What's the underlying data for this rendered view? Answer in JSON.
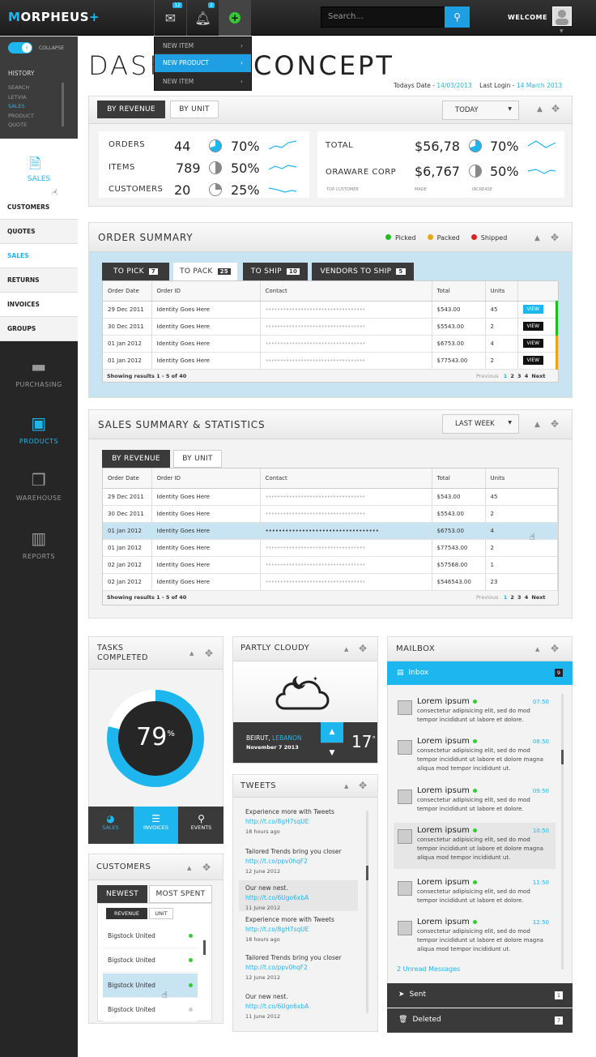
{
  "app": {
    "logo_prefix": "M",
    "logo_rest": "ORPHEUS",
    "logo_plus": "+"
  },
  "topbar": {
    "mail_badge": "12",
    "bell_badge": "2",
    "search_placeholder": "Search...",
    "welcome": "WELCOME"
  },
  "dropdown": {
    "items": [
      "NEW ITEM",
      "NEW PRODUCT",
      "NEW ITEM"
    ],
    "active_index": 1
  },
  "sidebar": {
    "collapse": "COLLAPSE",
    "history_title": "HISTORY",
    "history": [
      "SEARCH",
      "LETVIA",
      "SALES",
      "PRODUCT",
      "QUOTE"
    ],
    "sales_label": "SALES",
    "sub": [
      "CUSTOMERS",
      "QUOTES",
      "SALES",
      "RETURNS",
      "INVOICES",
      "GROUPS"
    ],
    "nav": [
      "PURCHASING",
      "PRODUCTS",
      "WAREHOUSE",
      "REPORTS"
    ]
  },
  "page": {
    "title_left": "DASH",
    "title_right": "CONCEPT",
    "todays_label": "Todays Date - ",
    "todays_date": "14/03/2013",
    "last_login_label": "Last Login - ",
    "last_login": "14 March 2013"
  },
  "overview": {
    "tabs": [
      "BY REVENUE",
      "BY UNIT"
    ],
    "period": "TODAY",
    "left": [
      {
        "label": "ORDERS",
        "value": "44",
        "pct": "70%",
        "fill": 0.7
      },
      {
        "label": "ITEMS",
        "value": "789",
        "pct": "50%",
        "fill": 0.5
      },
      {
        "label": "CUSTOMERS",
        "value": "20",
        "pct": "25%",
        "fill": 0.25
      }
    ],
    "right": [
      {
        "label": "TOTAL",
        "value": "$56,78",
        "pct": "70%",
        "fill": 0.7
      },
      {
        "label": "ORAWARE CORP",
        "value": "$6,767",
        "pct": "50%",
        "fill": 0.5
      }
    ],
    "subcaps": [
      "TOP CUSTOMER",
      "MADE",
      "INCREASE"
    ]
  },
  "order_summary": {
    "title": "ORDER SUMMARY",
    "legend": [
      {
        "label": "Picked",
        "color": "#22bb22"
      },
      {
        "label": "Packed",
        "color": "#e6a817"
      },
      {
        "label": "Shipped",
        "color": "#dd2222"
      }
    ],
    "tabs": [
      {
        "label": "TO PICK",
        "count": "7"
      },
      {
        "label": "TO PACK",
        "count": "25"
      },
      {
        "label": "TO SHIP",
        "count": "10"
      },
      {
        "label": "VENDORS TO SHIP",
        "count": "5"
      }
    ],
    "columns": [
      "Order Date",
      "Order ID",
      "Contact",
      "Total",
      "Units"
    ],
    "rows": [
      {
        "date": "29 Dec 2011",
        "id": "Identity Goes Here",
        "contact": "••••••••••••••••••••••••••••••••••",
        "total": "$543.00",
        "units": "45",
        "btn": "VIEW"
      },
      {
        "date": "30 Dec 2011",
        "id": "Identity Goes Here",
        "contact": "••••••••••••••••••••••••••••••••••",
        "total": "$5543.00",
        "units": "2",
        "btn": "VIEW"
      },
      {
        "date": "01 Jan 2012",
        "id": "Identity Goes Here",
        "contact": "••••••••••••••••••••••••••••••••••",
        "total": "$6753.00",
        "units": "4",
        "btn": "VIEW"
      },
      {
        "date": "01 Jan 2012",
        "id": "Identity Goes Here",
        "contact": "••••••••••••••••••••••••••••••••••",
        "total": "$77543.00",
        "units": "2",
        "btn": "VIEW"
      }
    ],
    "footer": "Showing results 1 - 5 of 40",
    "prev": "Previous",
    "pages": [
      "1",
      "2",
      "3",
      "4"
    ],
    "next": "Next"
  },
  "sales_summary": {
    "title": "SALES SUMMARY & STATISTICS",
    "period": "LAST WEEK",
    "tabs": [
      "BY REVENUE",
      "BY UNIT"
    ],
    "columns": [
      "Order Date",
      "Order ID",
      "Contact",
      "Total",
      "Units"
    ],
    "rows": [
      {
        "date": "29 Dec 2011",
        "id": "Identity Goes Here",
        "contact": "••••••••••••••••••••••••••••••••••",
        "total": "$543.00",
        "units": "45"
      },
      {
        "date": "30 Dec 2011",
        "id": "Identity Goes Here",
        "contact": "••••••••••••••••••••••••••••••••••",
        "total": "$5543.00",
        "units": "2"
      },
      {
        "date": "01 Jan 2012",
        "id": "Identity Goes Here",
        "contact": "••••••••••••••••••••••••••••••••••",
        "total": "$6753.00",
        "units": "4"
      },
      {
        "date": "01 Jan 2012",
        "id": "Identity Goes Here",
        "contact": "••••••••••••••••••••••••••••••••••",
        "total": "$77543.00",
        "units": "2"
      },
      {
        "date": "02 Jan 2012",
        "id": "Identity Goes Here",
        "contact": "••••••••••••••••••••••••••••••••••",
        "total": "$57568.00",
        "units": "1"
      },
      {
        "date": "02 Jan 2012",
        "id": "Identity Goes Here",
        "contact": "••••••••••••••••••••••••••••••••••",
        "total": "$546543.00",
        "units": "23"
      }
    ],
    "footer": "Showing results 1 - 5 of 40",
    "prev": "Previous",
    "pages": [
      "1",
      "2",
      "3",
      "4"
    ],
    "next": "Next"
  },
  "tasks": {
    "title1": "TASKS",
    "title2": "COMPLETED",
    "percent": "79",
    "pct_sign": "%",
    "fill": 0.79,
    "tabs": [
      "SALES",
      "INVOICES",
      "EVENTS"
    ]
  },
  "weather": {
    "title": "PARTLY CLOUDY",
    "city": "BEIRUT, ",
    "country": "LEBANON",
    "date": "November 7 2013",
    "temp": "17",
    "deg": "°"
  },
  "tweets": {
    "title": "TWEETS",
    "items": [
      {
        "text": "Experience more with Tweets ",
        "link": "http://t.co/8gH7sqUE",
        "time": "18 hours ago"
      },
      {
        "text": "Tailored Trends bring you closer ",
        "link": "http://t.co/ppv0hqF2",
        "time": "12 June 2012"
      },
      {
        "text": "Our new nest. ",
        "link": "http://t.co/6Ugo6xbA",
        "time": "11 June 2012"
      },
      {
        "text": "Experience more with Tweets ",
        "link": "http://t.co/8gH7sqUE",
        "time": "18 hours ago"
      },
      {
        "text": "Tailored Trends bring you closer ",
        "link": "http://t.co/ppv0hqF2",
        "time": "12 June 2012"
      },
      {
        "text": "Our new nest. ",
        "link": "http://t.co/6Ugo6xbA",
        "time": "11 June 2012"
      }
    ]
  },
  "customers": {
    "title": "CUSTOMERS",
    "tabs": [
      "NEWEST",
      "MOST SPENT"
    ],
    "subtabs": [
      "REVENUE",
      "UNIT"
    ],
    "items": [
      "Bigstock United",
      "Bigstock United",
      "Bigstock United",
      "Bigstock United"
    ]
  },
  "mailbox": {
    "title": "MAILBOX",
    "inbox": "Inbox",
    "inbox_count": "9",
    "items": [
      {
        "name": "Lorem ipsum",
        "time": "07:50",
        "text": "consectetur adipisicing elit, sed do mod tempor incididunt ut labore et dolore."
      },
      {
        "name": "Lorem ipsum",
        "time": "08:50",
        "text": "consectetur adipisicing elit, sed do mod tempor incididunt ut labore et dolore magna aliqua mod tempor incididunt ut."
      },
      {
        "name": "Lorem ipsum",
        "time": "09:50",
        "text": "consectetur adipisicing elit, sed do mod tempor incididunt ut labore et dolore."
      },
      {
        "name": "Lorem ipsum",
        "time": "10:50",
        "text": "consectetur adipisicing elit, sed do mod tempor incididunt ut labore et dolore magna aliqua mod tempor incididunt ut."
      },
      {
        "name": "Lorem ipsum",
        "time": "11:50",
        "text": "consectetur adipisicing elit, sed do mod tempor incididunt ut labore et dolore."
      },
      {
        "name": "Lorem ipsum",
        "time": "12:50",
        "text": "consectetur adipisicing elit, sed do mod tempor incididunt ut labore et dolore magna aliqua mod tempor incididunt ut."
      }
    ],
    "unread": "2 Unread Messages",
    "sent": "Sent",
    "sent_count": "1",
    "deleted": "Deleted",
    "deleted_count": "7"
  },
  "colors": {
    "accent": "#1eb6ef",
    "dark": "#262626"
  }
}
